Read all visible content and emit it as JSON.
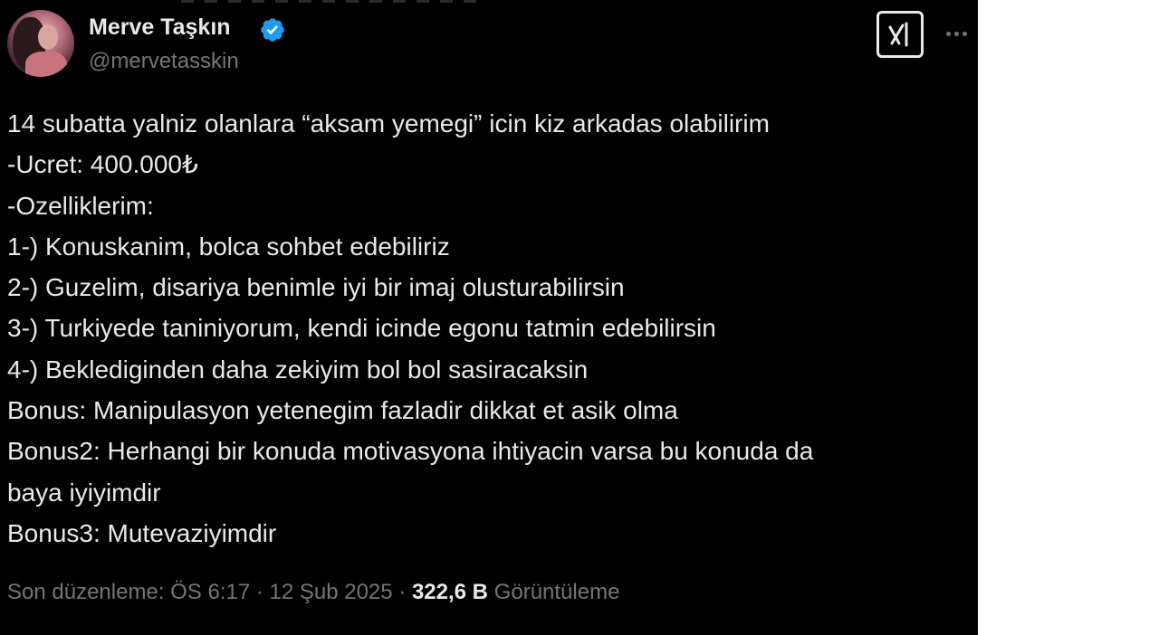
{
  "author": {
    "display_name": "Merve Taşkın",
    "handle": "@mervetasskin",
    "verified": true,
    "verified_color": "#1d9bf0"
  },
  "toolbar": {
    "grok_icon": "grok-icon",
    "more_icon": "more-options-icon"
  },
  "tweet": {
    "lines": [
      "14 subatta yalniz olanlara “aksam yemegi” icin kiz arkadas olabilirim",
      "-Ucret: 400.000₺",
      "-Ozelliklerim:",
      "1-) Konuskanim, bolca sohbet edebiliriz",
      "2-) Guzelim, disariya benimle iyi bir imaj olusturabilirsin",
      "3-) Turkiyede taniniyorum, kendi icinde egonu tatmin edebilirsin",
      "4-) BekledigINden daha zekiyim bol bol sasiracaksin",
      "Bonus: Manipulasyon yetenegim fazladir dikkat et asik olma",
      "Bonus2: Herhangi bir konuda motivasyona ihtiyacin varsa bu konuda da",
      "baya iyiyimdir",
      "Bonus3: Mutevaziyimdir"
    ]
  },
  "meta": {
    "edited_label": "Son düzenleme: ÖS 6:17 · 12 Şub 2025 · ",
    "views_count": "322,6 B",
    "views_label": " Görüntüleme"
  },
  "colors": {
    "background": "#000000",
    "text": "#e7e9ea",
    "secondary_text": "#71767b"
  }
}
